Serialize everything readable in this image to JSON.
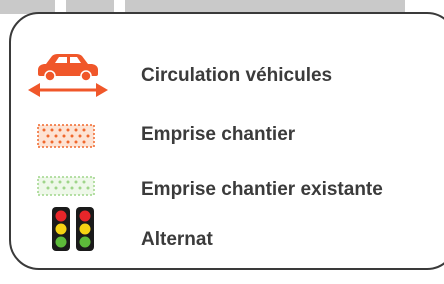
{
  "legend": {
    "items": [
      {
        "label": "Circulation véhicules",
        "symbol": "car-with-double-arrow-icon",
        "color": "#f0572a"
      },
      {
        "label": "Emprise chantier",
        "symbol": "dotted-hatched-area-orange-icon",
        "color": "#f0682d"
      },
      {
        "label": "Emprise chantier existante",
        "symbol": "dotted-hatched-area-green-icon",
        "color": "#9fd58a"
      },
      {
        "label": "Alternat",
        "symbol": "traffic-lights-icon",
        "colors": {
          "red": "#e8262a",
          "yellow": "#f5d313",
          "green": "#5dbb3a",
          "body": "#1a1a1a"
        }
      }
    ]
  }
}
